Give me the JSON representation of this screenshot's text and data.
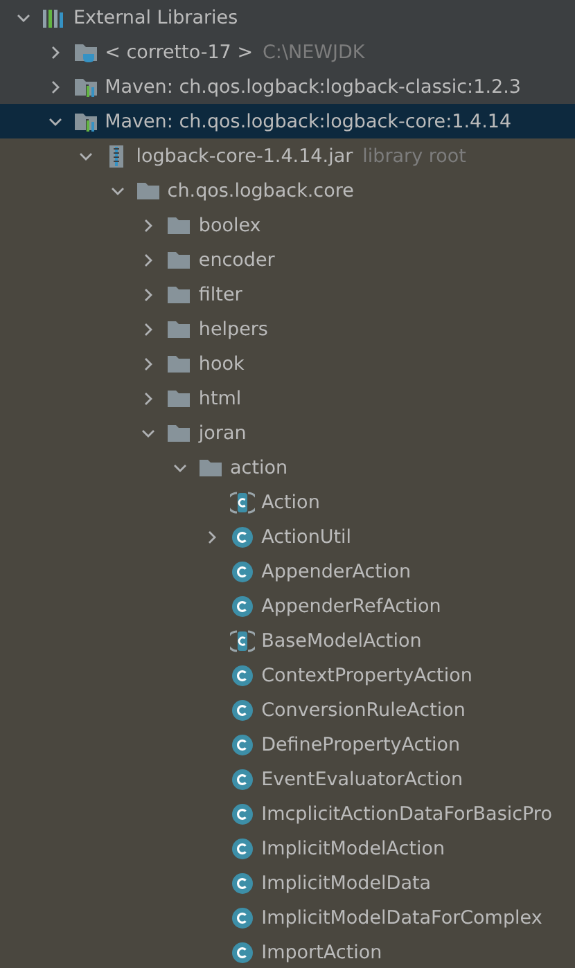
{
  "tree": [
    {
      "label": "External Libraries",
      "kind": "libraries",
      "expanded": true,
      "selected": false,
      "children": [
        {
          "label": "< corretto-17 >",
          "hint": "C:\\NEWJDK",
          "kind": "jdk",
          "expanded": false,
          "selected": false
        },
        {
          "label": "Maven: ch.qos.logback:logback-classic:1.2.3",
          "kind": "maven",
          "expanded": false,
          "selected": false
        },
        {
          "label": "Maven: ch.qos.logback:logback-core:1.4.14",
          "kind": "maven",
          "expanded": true,
          "selected": true,
          "children_highlighted": true,
          "children": [
            {
              "label": "logback-core-1.4.14.jar",
              "hint": "library root",
              "kind": "jar",
              "expanded": true,
              "selected": false,
              "children": [
                {
                  "label": "ch.qos.logback.core",
                  "kind": "package",
                  "expanded": true,
                  "selected": false,
                  "children": [
                    {
                      "label": "boolex",
                      "kind": "package",
                      "expanded": false,
                      "selected": false
                    },
                    {
                      "label": "encoder",
                      "kind": "package",
                      "expanded": false,
                      "selected": false
                    },
                    {
                      "label": "filter",
                      "kind": "package",
                      "expanded": false,
                      "selected": false
                    },
                    {
                      "label": "helpers",
                      "kind": "package",
                      "expanded": false,
                      "selected": false
                    },
                    {
                      "label": "hook",
                      "kind": "package",
                      "expanded": false,
                      "selected": false
                    },
                    {
                      "label": "html",
                      "kind": "package",
                      "expanded": false,
                      "selected": false
                    },
                    {
                      "label": "joran",
                      "kind": "package",
                      "expanded": true,
                      "selected": false,
                      "children": [
                        {
                          "label": "action",
                          "kind": "package",
                          "expanded": true,
                          "selected": false,
                          "children": [
                            {
                              "label": "Action",
                              "kind": "abstract_class",
                              "selected": false
                            },
                            {
                              "label": "ActionUtil",
                              "kind": "class",
                              "expanded": false,
                              "selected": false
                            },
                            {
                              "label": "AppenderAction",
                              "kind": "class",
                              "selected": false
                            },
                            {
                              "label": "AppenderRefAction",
                              "kind": "class",
                              "selected": false
                            },
                            {
                              "label": "BaseModelAction",
                              "kind": "abstract_class",
                              "selected": false
                            },
                            {
                              "label": "ContextPropertyAction",
                              "kind": "class",
                              "selected": false
                            },
                            {
                              "label": "ConversionRuleAction",
                              "kind": "class",
                              "selected": false
                            },
                            {
                              "label": "DefinePropertyAction",
                              "kind": "class",
                              "selected": false
                            },
                            {
                              "label": "EventEvaluatorAction",
                              "kind": "class",
                              "selected": false
                            },
                            {
                              "label": "ImcplicitActionDataForBasicPro",
                              "kind": "class",
                              "selected": false
                            },
                            {
                              "label": "ImplicitModelAction",
                              "kind": "class",
                              "selected": false
                            },
                            {
                              "label": "ImplicitModelData",
                              "kind": "class",
                              "selected": false
                            },
                            {
                              "label": "ImplicitModelDataForComplex",
                              "kind": "class",
                              "selected": false
                            },
                            {
                              "label": "ImportAction",
                              "kind": "class",
                              "selected": false
                            }
                          ]
                        }
                      ]
                    }
                  ]
                }
              ]
            }
          ]
        }
      ]
    }
  ]
}
